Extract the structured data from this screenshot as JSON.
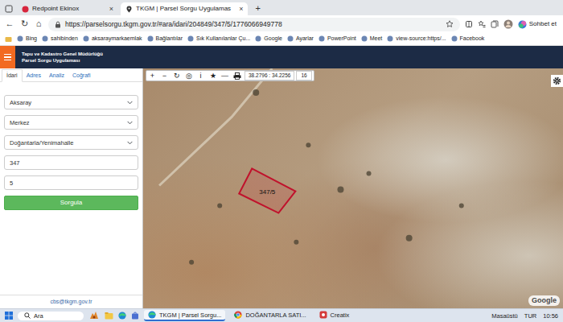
{
  "browser": {
    "tabs": [
      {
        "label": "Redpoint Ekinox",
        "close": "×",
        "selected": false
      },
      {
        "label": "TKGM | Parsel Sorgu Uygulamas",
        "close": "×",
        "selected": true
      }
    ],
    "new_tab": "+",
    "nav_buttons": [
      "←",
      "↻",
      "⌂"
    ],
    "url": "https://parselsorgu.tkgm.gov.tr/#ara/idari/204849/347/5/1776066949778",
    "chat": "Sohbet et",
    "bookmarks": [
      "Bing",
      "sahibinden",
      "aksaraymarkaemlak",
      "Bağlantılar",
      "Sık Kullanılanlar Çu...",
      "Google",
      "Ayarlar",
      "PowerPoint",
      "Meet",
      "view-source:https/...",
      "Facebook"
    ]
  },
  "app": {
    "title": "Tapu ve Kadastro Genel Müdürlüğü",
    "subtitle": "Parsel Sorgu Uygulaması"
  },
  "sidebar": {
    "tabs": [
      {
        "label": "İdari",
        "selected": true
      },
      {
        "label": "Adres",
        "selected": false
      },
      {
        "label": "Analiz",
        "selected": false
      },
      {
        "label": "Coğrafi",
        "selected": false
      }
    ],
    "fields": [
      {
        "kind": "select",
        "value": "Aksaray"
      },
      {
        "kind": "select",
        "value": "Merkez"
      },
      {
        "kind": "select",
        "value": "Doğantarla/Yenimahalle"
      },
      {
        "kind": "input",
        "value": "347"
      },
      {
        "kind": "input",
        "value": "5"
      }
    ],
    "button": "Sorgula",
    "footer": "cbs@tkgm.gov.tr"
  },
  "map": {
    "tools": [
      "+",
      "−",
      "↻",
      "◎",
      "i",
      "★",
      "—"
    ],
    "coordinates": "38.2796 : 34.2256",
    "zoom": "16",
    "parcel_label": "347/5",
    "attribution": "Google"
  },
  "taskbar": {
    "search": "Ara",
    "apps": [
      {
        "label": "TKGM | Parsel Sorgu...",
        "selected": true
      },
      {
        "label": "DOĞANTARLA SATI...",
        "selected": false
      },
      {
        "label": "Creatix",
        "selected": false
      }
    ],
    "desktop": "Masaüstü",
    "language": "TUR",
    "time": "10:56"
  }
}
